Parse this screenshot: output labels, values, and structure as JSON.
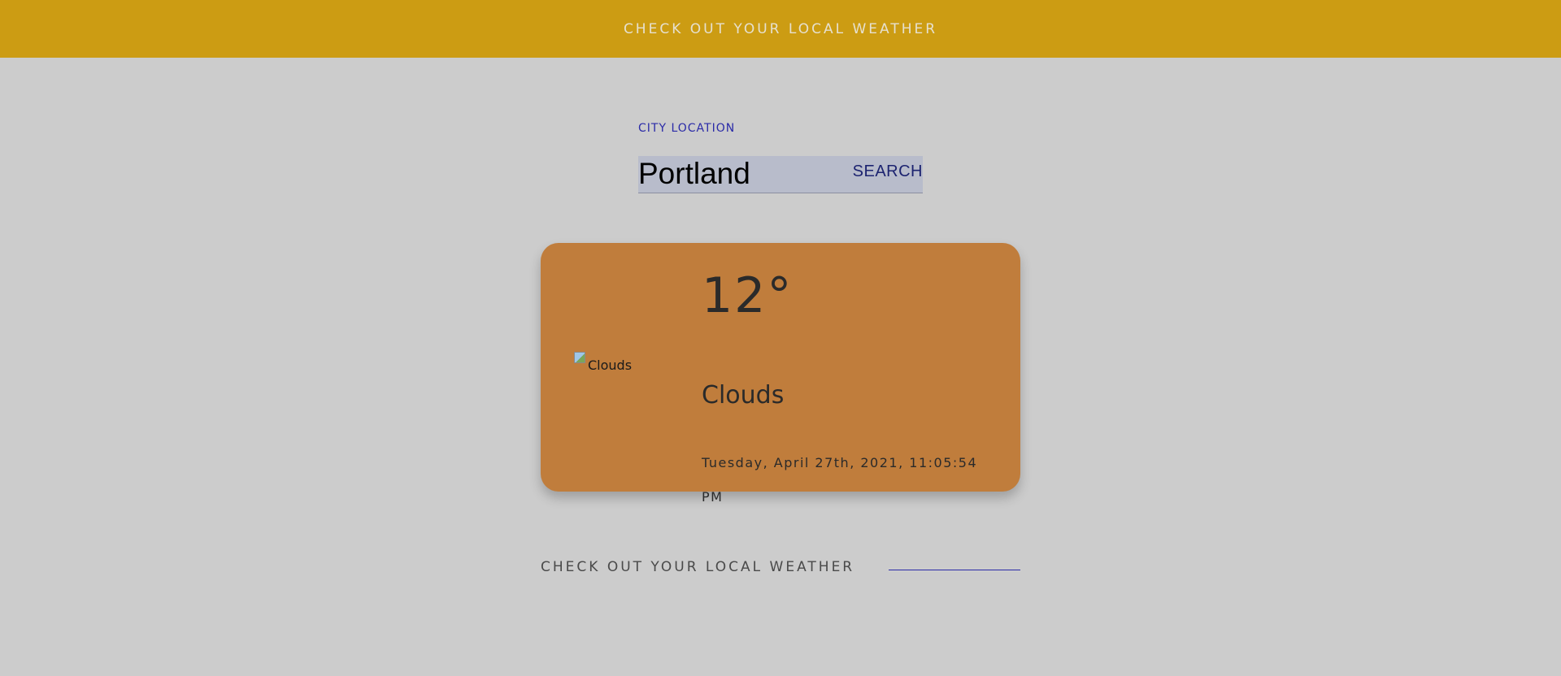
{
  "header": {
    "title": "CHECK OUT YOUR LOCAL WEATHER"
  },
  "search": {
    "label": "CITY LOCATION",
    "value": "Portland",
    "button_label": "SEARCH"
  },
  "weather": {
    "temperature": "12°",
    "icon_alt": "Clouds",
    "icon": "broken-image-icon",
    "description": "Clouds",
    "datetime": "Tuesday, April 27th, 2021, 11:05:54 PM"
  },
  "footer": {
    "text": "CHECK OUT YOUR LOCAL WEATHER"
  },
  "colors": {
    "header_bg": "#cc9c13",
    "page_bg": "#cccccc",
    "card_bg": "#c07d3c",
    "accent": "#2b2ba8"
  }
}
